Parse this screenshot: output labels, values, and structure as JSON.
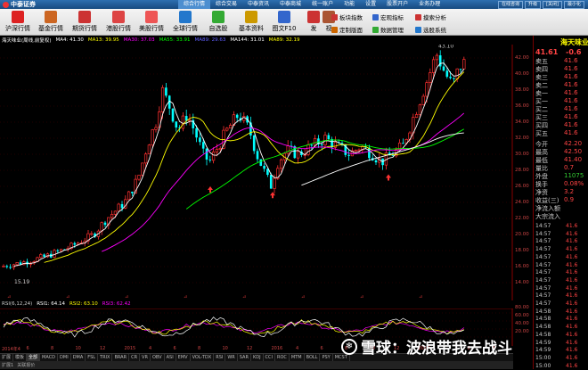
{
  "menubar": {
    "logo": "中泰证券",
    "items": [
      "综合行情",
      "综合交易",
      "中泰资讯",
      "中泰商城",
      "统一账户",
      "功能",
      "设置",
      "股票开户",
      "业务办理"
    ],
    "buttons": [
      "在线咨询",
      "升级",
      "[关闭]",
      "最小化"
    ]
  },
  "toolbar": {
    "buttons": [
      {
        "label": "沪深行情",
        "icon": "sh-sz-quote-icon",
        "color": "#d22"
      },
      {
        "label": "基金行情",
        "icon": "fund-quote-icon",
        "color": "#c62"
      },
      {
        "label": "期货行情",
        "icon": "futures-quote-icon",
        "color": "#c33"
      },
      {
        "label": "港股行情",
        "icon": "hk-quote-icon",
        "color": "#d44"
      },
      {
        "label": "美股行情",
        "icon": "us-quote-icon",
        "color": "#e55"
      },
      {
        "label": "全球行情",
        "icon": "global-quote-icon",
        "color": "#27c"
      },
      {
        "label": "自选股",
        "icon": "watchlist-icon",
        "color": "#3a3"
      },
      {
        "label": "基本资料",
        "icon": "profile-icon",
        "color": "#c90"
      },
      {
        "label": "图文F10",
        "icon": "f10-icon",
        "color": "#36c"
      },
      {
        "label": "发",
        "icon": "publish-icon",
        "color": "#c33"
      },
      {
        "label": "视",
        "icon": "video-icon",
        "color": "#a53"
      }
    ],
    "small": [
      {
        "label": "板块指数",
        "icon": "sector-index-icon",
        "color": "#c33"
      },
      {
        "label": "宏观指标",
        "icon": "macro-icon",
        "color": "#36c"
      },
      {
        "label": "摸索分析",
        "icon": "analysis-icon",
        "color": "#c33"
      },
      {
        "label": "定制版面",
        "icon": "layout-icon",
        "color": "#c60"
      },
      {
        "label": "数据管理",
        "icon": "data-mgmt-icon",
        "color": "#3a3"
      },
      {
        "label": "选股系统",
        "icon": "stock-pick-icon",
        "color": "#27c"
      }
    ]
  },
  "chart": {
    "stock": "海天味业(周线,前复权)",
    "ma": [
      {
        "label": "MA4: 41.30",
        "color": "#ffffff"
      },
      {
        "label": "MA13: 39.95",
        "color": "#ffff00"
      },
      {
        "label": "MA30: 37.03",
        "color": "#ff00ff"
      },
      {
        "label": "MA55: 33.91",
        "color": "#00ff00"
      },
      {
        "label": "MA89: 29.63",
        "color": "#6060ff"
      },
      {
        "label": "MA144: 31.01",
        "color": "#ffffff"
      },
      {
        "label": "MA89: 32.19",
        "color": "#ffff00"
      }
    ],
    "high_label": "43.10",
    "low_label": "15.19",
    "yticks": [
      "42.00",
      "40.00",
      "38.00",
      "36.00",
      "34.00",
      "32.00",
      "30.00",
      "28.00",
      "26.00",
      "24.00",
      "22.00",
      "20.00",
      "18.00",
      "16.00",
      "14.00"
    ],
    "ind_yticks": [
      "80.00",
      "60.00",
      "40.00",
      "20.00"
    ],
    "up_color": "#ff3030",
    "down_color": "#00ffff"
  },
  "indicator": {
    "name": "RSI(6,12,24)",
    "rsi1": "RSI1: 64.14",
    "rsi2": "RSI2: 63.10",
    "rsi3": "RSI3: 62.42",
    "rsi1_color": "#ffffff",
    "rsi2_color": "#ffff00",
    "rsi3_color": "#ff00ff"
  },
  "dates": [
    "2014年4",
    "6",
    "8",
    "10",
    "12",
    "2015",
    "4",
    "6",
    "8",
    "10",
    "12",
    "2016",
    "4",
    "6",
    "8",
    "10",
    "12",
    "2017",
    "4",
    "6",
    "8"
  ],
  "tabs": [
    "扩展",
    "模板",
    "全部",
    "MACD",
    "DMI",
    "DMA",
    "FSL",
    "TRIX",
    "BRAR",
    "CR",
    "VR",
    "OBV",
    "ASI",
    "EMV",
    "VOL-TDX",
    "RSI",
    "WR",
    "SAR",
    "KDJ",
    "CCI",
    "ROC",
    "MTM",
    "BOLL",
    "PSY",
    "MCST"
  ],
  "statusbar": [
    "扩展1",
    "关联报价"
  ],
  "side": {
    "title": "海天味业",
    "price": "41.61",
    "change": "-0.6",
    "asks": [
      {
        "label": "卖五",
        "v": "41.6"
      },
      {
        "label": "卖四",
        "v": "41.6"
      },
      {
        "label": "卖三",
        "v": "41.6"
      },
      {
        "label": "卖二",
        "v": "41.6"
      },
      {
        "label": "卖一",
        "v": "41.6"
      }
    ],
    "bids": [
      {
        "label": "买一",
        "v": "41.6"
      },
      {
        "label": "买二",
        "v": "41.6"
      },
      {
        "label": "买三",
        "v": "41.6"
      },
      {
        "label": "买四",
        "v": "41.6"
      },
      {
        "label": "买五",
        "v": "41.6"
      }
    ],
    "stats": [
      {
        "label": "今开",
        "v": "42.20"
      },
      {
        "label": "最高",
        "v": "42.50"
      },
      {
        "label": "最低",
        "v": "41.40"
      },
      {
        "label": "量比",
        "v": "0.7"
      },
      {
        "label": "外盘",
        "v": "11075"
      },
      {
        "label": "换手",
        "v": "0.08%"
      },
      {
        "label": "净资",
        "v": "3.2"
      },
      {
        "label": "收益(三)",
        "v": "0.9"
      }
    ],
    "flow_labels": [
      "净流入额",
      "大宗流入"
    ],
    "ticks": [
      "14:57",
      "14:57",
      "14:57",
      "14:57",
      "14:57",
      "14:57",
      "14:57",
      "14:57",
      "14:57",
      "14:57",
      "14:57",
      "14:58",
      "14:58",
      "14:58",
      "14:58",
      "14:59",
      "14:59",
      "15:00",
      "15:00",
      "15:00",
      "15:00"
    ],
    "tick_v": "41.6"
  },
  "watermark": "雪球：波浪带我去战斗"
}
